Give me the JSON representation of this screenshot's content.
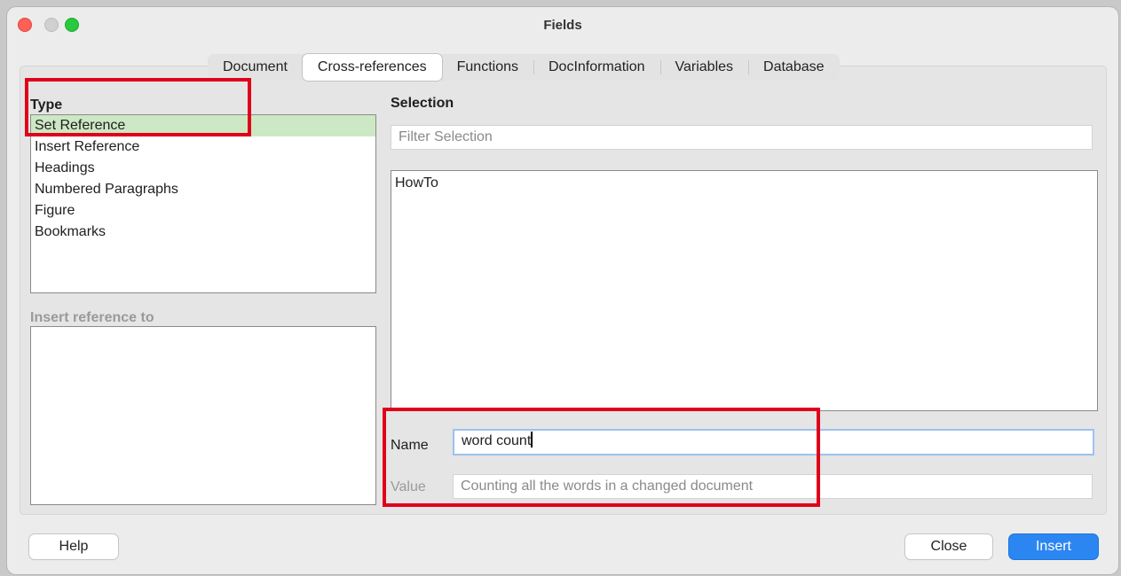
{
  "window": {
    "title": "Fields"
  },
  "tabs": [
    {
      "label": "Document"
    },
    {
      "label": "Cross-references"
    },
    {
      "label": "Functions"
    },
    {
      "label": "DocInformation"
    },
    {
      "label": "Variables"
    },
    {
      "label": "Database"
    }
  ],
  "active_tab": "Cross-references",
  "type_section": {
    "label": "Type",
    "items": [
      {
        "label": "Set Reference",
        "selected": true
      },
      {
        "label": "Insert Reference"
      },
      {
        "label": "Headings"
      },
      {
        "label": "Numbered Paragraphs"
      },
      {
        "label": "Figure"
      },
      {
        "label": "Bookmarks"
      }
    ]
  },
  "insert_reference_to": {
    "label": "Insert reference to",
    "items": []
  },
  "selection": {
    "label": "Selection",
    "filter_placeholder": "Filter Selection",
    "items": [
      {
        "label": "HowTo"
      }
    ]
  },
  "name_field": {
    "label": "Name",
    "value": "word count"
  },
  "value_field": {
    "label": "Value",
    "placeholder": "Counting all the words in a changed document"
  },
  "buttons": {
    "help": "Help",
    "close": "Close",
    "insert": "Insert"
  },
  "colors": {
    "selection_highlight": "#cde8c4",
    "annotation_red": "#e0001a",
    "primary_button": "#2b86f2"
  }
}
